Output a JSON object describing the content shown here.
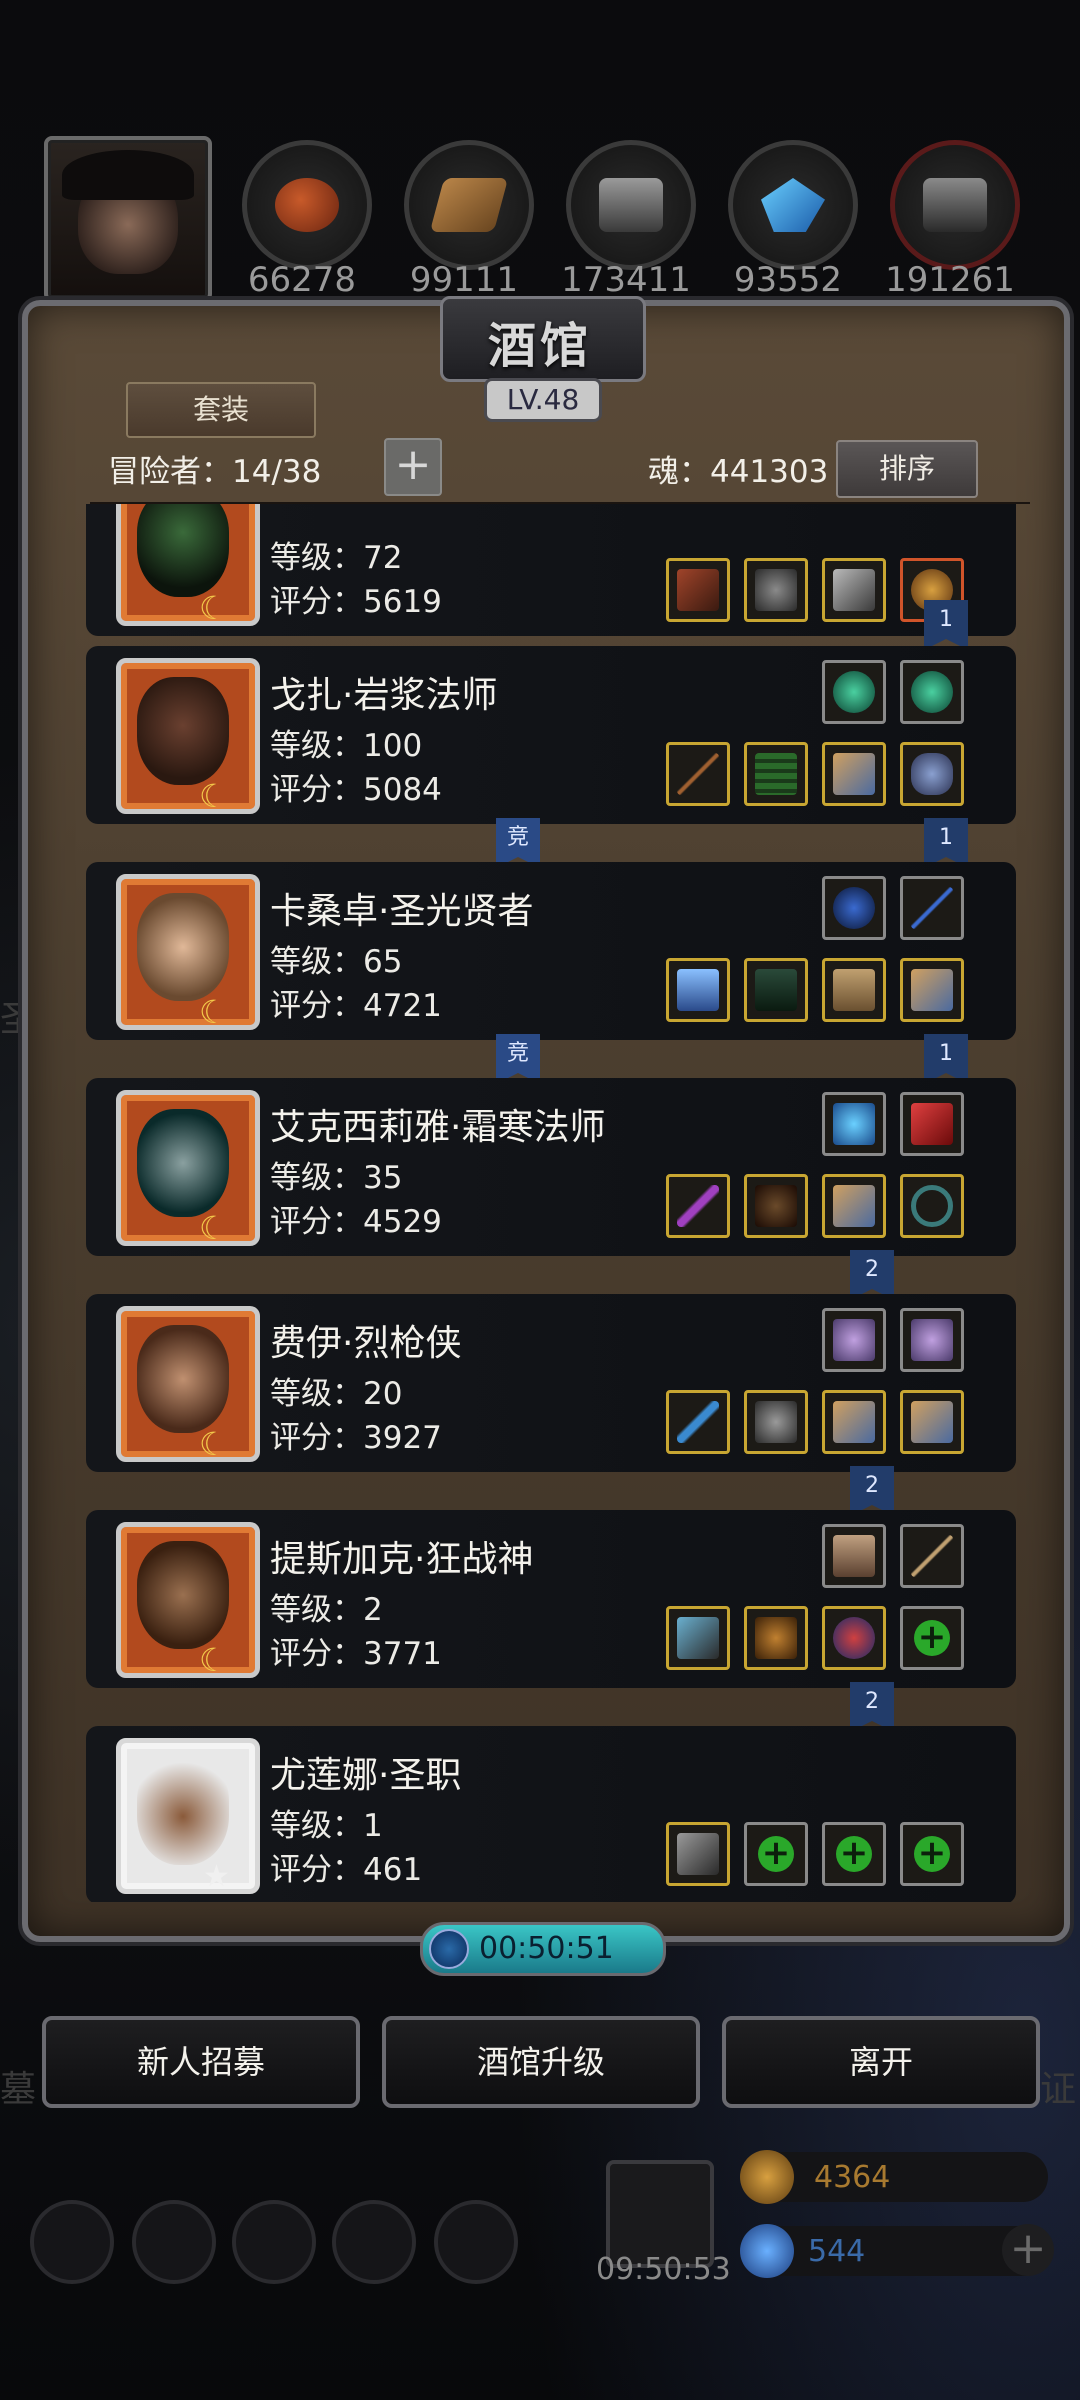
{
  "resources": [
    {
      "icon": "meat-icon",
      "value": "66278"
    },
    {
      "icon": "wood-icon",
      "value": "99111"
    },
    {
      "icon": "stone-icon",
      "value": "173411"
    },
    {
      "icon": "crystal-icon",
      "value": "93552"
    },
    {
      "icon": "iron-icon",
      "value": "191261"
    }
  ],
  "panel": {
    "title": "酒馆",
    "level": "LV.48",
    "tab_label": "套装",
    "adventurers": "冒险者：14/38",
    "soul": "魂：441303",
    "sort_label": "排序",
    "add_symbol": "+"
  },
  "heroes": [
    {
      "name": "",
      "level": "等级：72",
      "score": "评分：5619"
    },
    {
      "name": "戈扎·岩浆法师",
      "level": "等级：100",
      "score": "评分：5084"
    },
    {
      "name": "卡桑卓·圣光贤者",
      "level": "等级：65",
      "score": "评分：4721"
    },
    {
      "name": "艾克西莉雅·霜寒法师",
      "level": "等级：35",
      "score": "评分：4529"
    },
    {
      "name": "费伊·烈枪侠",
      "level": "等级：20",
      "score": "评分：3927"
    },
    {
      "name": "提斯加克·狂战神",
      "level": "等级：2",
      "score": "评分：3771"
    },
    {
      "name": "尤莲娜·圣职",
      "level": "等级：1",
      "score": "评分：461"
    }
  ],
  "ribbons": {
    "r1": "1",
    "r2": "竞",
    "r3": "1",
    "r4": "竞",
    "r5": "1",
    "r6": "2",
    "r7": "2",
    "r8": "2"
  },
  "timer": "00:50:51",
  "buttons": {
    "recruit": "新人招募",
    "upgrade": "酒馆升级",
    "leave": "离开"
  },
  "footer": {
    "time": "09:50:53",
    "gold": "4364",
    "gems": "544",
    "plus": "+"
  },
  "side": {
    "left": "圣",
    "right": "证",
    "left2": "墓"
  },
  "colors": {
    "accent_gold": "#c8a632",
    "ribbon_blue": "#223c6a",
    "timer_cyan": "#3ac6c6"
  }
}
